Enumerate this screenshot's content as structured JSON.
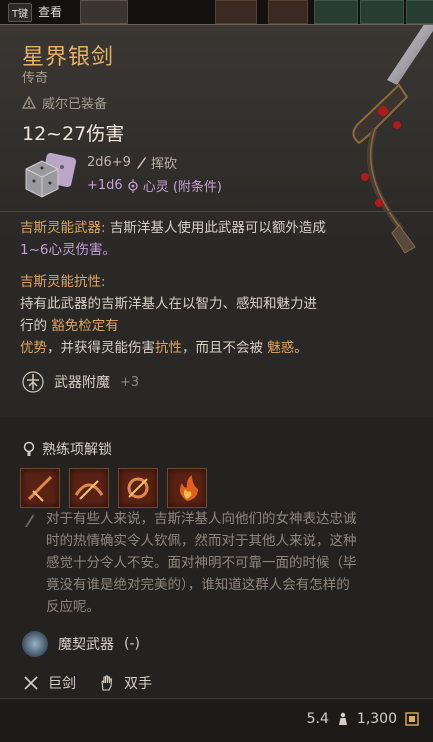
{
  "topbar": {
    "key_label": "T键",
    "view_label": "查看"
  },
  "item": {
    "name": "星界银剑",
    "rarity": "传奇",
    "equipped_by": "威尔已装备",
    "damage": "12~27伤害",
    "base_roll": "2d6+9",
    "damage_type": "挥砍",
    "bonus_roll": "+1d6",
    "bonus_type": "心灵 (附条件)"
  },
  "passives": {
    "p1_name": "吉斯灵能武器:",
    "p1_text": "吉斯洋基人使用此武器可以额外造成",
    "p1_value": "1~6心灵伤害。",
    "p2_name": "吉斯灵能抗性:",
    "p2_line1": "持有此武器的吉斯洋基人在以智力、感知和魅力进",
    "p2_line2_a": "行的",
    "p2_line2_b": "豁免检定有",
    "p2_line3_a": "优势",
    "p2_line3_b": "，并获得灵能伤害",
    "p2_line3_c": "抗性",
    "p2_line3_d": "，而且不会被",
    "p2_line3_e": "魅惑",
    "p2_line3_f": "。"
  },
  "enchant": {
    "label": "武器附魔",
    "value": "+3"
  },
  "proficiency": {
    "label": "熟练项解锁",
    "icons": [
      "proficiency-slash-icon",
      "proficiency-lunge-icon",
      "proficiency-flourish-icon",
      "proficiency-fire-icon"
    ]
  },
  "lore": {
    "line1": "对于有些人来说，吉斯洋基人向他们的女神表达忠诚",
    "line2": "时的热情确实令人钦佩，然而对于其他人来说，这种",
    "line3": "感觉十分令人不安。面对神明不可靠一面的时候（毕",
    "line4": "竟没有谁是绝对完美的），谁知道这群人会有怎样的",
    "line5": "反应呢。"
  },
  "pact": {
    "label": "魔契武器",
    "suffix": "(-)"
  },
  "tags": {
    "type": "巨剑",
    "handed": "双手"
  },
  "footer": {
    "weight": "5.4",
    "price": "1,300"
  }
}
